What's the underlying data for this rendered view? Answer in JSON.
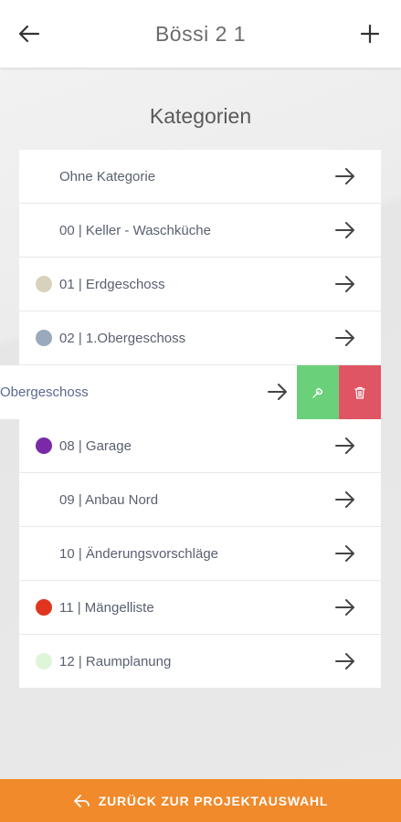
{
  "header": {
    "title": "Bössi 2 1"
  },
  "section": {
    "title": "Kategorien"
  },
  "categories": [
    {
      "label": "Ohne Kategorie",
      "color": ""
    },
    {
      "label": "00 | Keller - Waschküche",
      "color": ""
    },
    {
      "label": "01 | Erdgeschoss",
      "color": "#d8d2bc"
    },
    {
      "label": "02 | 1.Obergeschoss",
      "color": "#9aa9bb"
    },
    {
      "label": "Obergeschoss",
      "color": "",
      "swiped": true
    },
    {
      "label": "08 | Garage",
      "color": "#7a2aa8"
    },
    {
      "label": "09 | Anbau Nord",
      "color": ""
    },
    {
      "label": "10 | Änderungsvorschläge",
      "color": ""
    },
    {
      "label": "11 | Mängelliste",
      "color": "#e0361f"
    },
    {
      "label": "12 | Raumplanung",
      "color": "#dff5da"
    }
  ],
  "footer": {
    "label": "ZURÜCK ZUR PROJEKTAUSWAHL"
  },
  "colors": {
    "accent": "#f08a2b",
    "edit": "#6bd07a",
    "delete": "#e05563"
  },
  "icons": [
    "back-arrow-icon",
    "plus-icon",
    "arrow-right-icon",
    "wrench-icon",
    "trash-icon",
    "return-icon"
  ]
}
